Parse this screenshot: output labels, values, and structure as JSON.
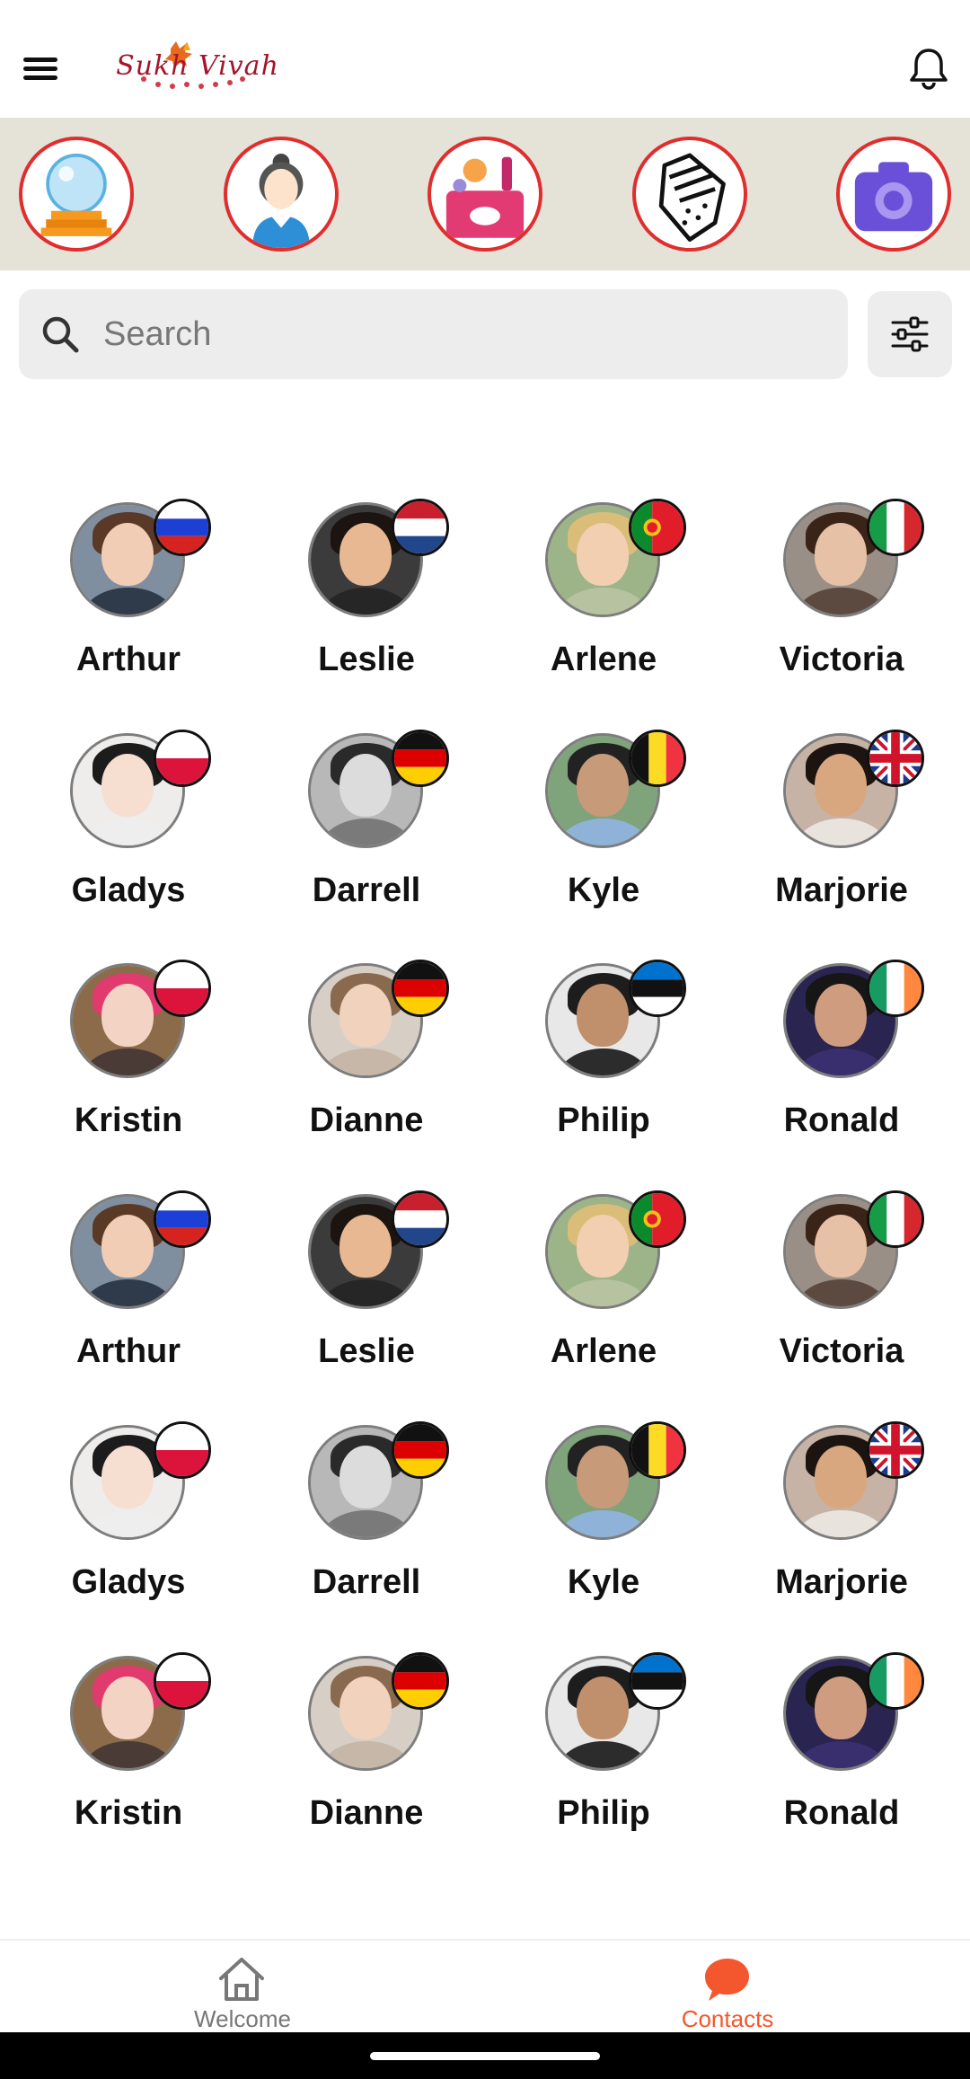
{
  "app": {
    "logo_text": "Sukh Vivah"
  },
  "search": {
    "placeholder": "Search",
    "value": ""
  },
  "categories": [
    {
      "name": "crystal-ball-icon"
    },
    {
      "name": "receptionist-icon"
    },
    {
      "name": "cosmetics-icon"
    },
    {
      "name": "palm-reading-icon"
    },
    {
      "name": "camera-icon"
    }
  ],
  "contacts": [
    {
      "name": "Arthur",
      "flag": "russia"
    },
    {
      "name": "Leslie",
      "flag": "netherlands"
    },
    {
      "name": "Arlene",
      "flag": "portugal"
    },
    {
      "name": "Victoria",
      "flag": "italy"
    },
    {
      "name": "Gladys",
      "flag": "poland"
    },
    {
      "name": "Darrell",
      "flag": "germany"
    },
    {
      "name": "Kyle",
      "flag": "belgium"
    },
    {
      "name": "Marjorie",
      "flag": "united-kingdom"
    },
    {
      "name": "Kristin",
      "flag": "poland"
    },
    {
      "name": "Dianne",
      "flag": "germany"
    },
    {
      "name": "Philip",
      "flag": "estonia"
    },
    {
      "name": "Ronald",
      "flag": "ireland"
    },
    {
      "name": "Arthur",
      "flag": "russia"
    },
    {
      "name": "Leslie",
      "flag": "netherlands"
    },
    {
      "name": "Arlene",
      "flag": "portugal"
    },
    {
      "name": "Victoria",
      "flag": "italy"
    },
    {
      "name": "Gladys",
      "flag": "poland"
    },
    {
      "name": "Darrell",
      "flag": "germany"
    },
    {
      "name": "Kyle",
      "flag": "belgium"
    },
    {
      "name": "Marjorie",
      "flag": "united-kingdom"
    },
    {
      "name": "Kristin",
      "flag": "poland"
    },
    {
      "name": "Dianne",
      "flag": "germany"
    },
    {
      "name": "Philip",
      "flag": "estonia"
    },
    {
      "name": "Ronald",
      "flag": "ireland"
    }
  ],
  "bottom_nav": {
    "welcome_label": "Welcome",
    "contacts_label": "Contacts"
  },
  "colors": {
    "accent": "#f4562d",
    "strip_background": "#e5e2d7",
    "category_ring": "#e02d2d",
    "inactive_nav": "#777777"
  }
}
